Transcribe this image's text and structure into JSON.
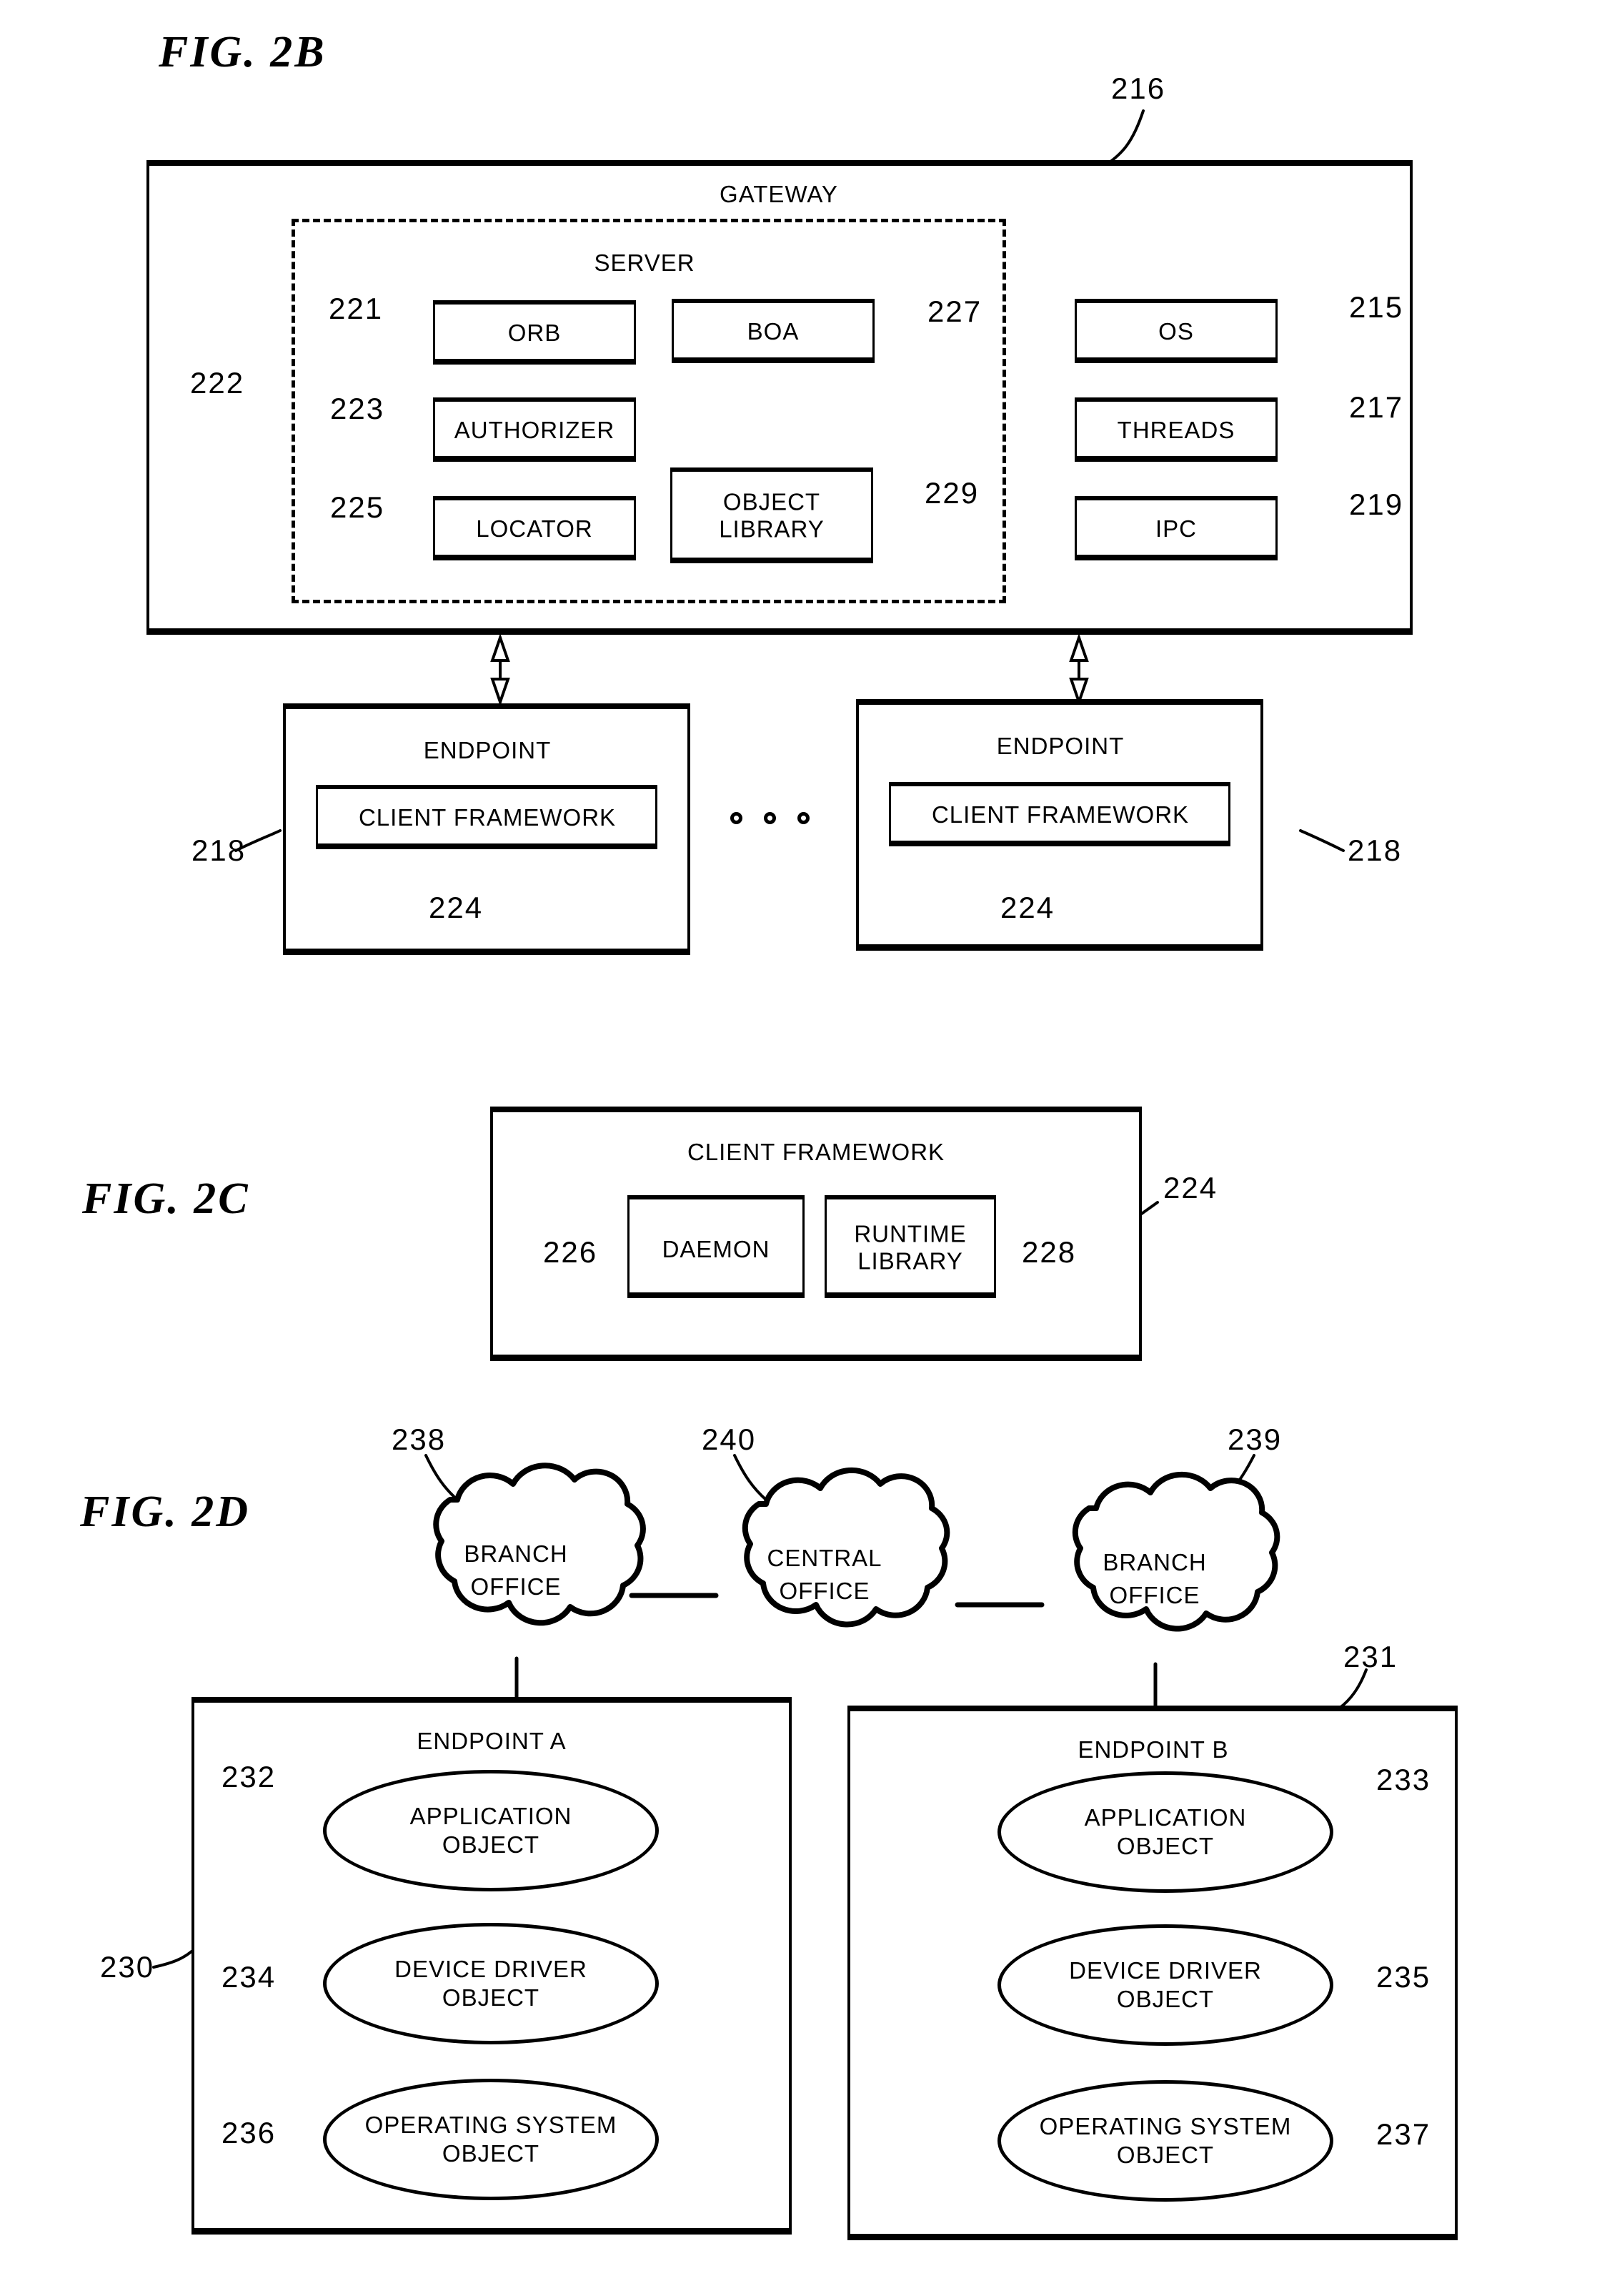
{
  "figures": {
    "fig2b": {
      "title": "FIG.  2B",
      "gateway": {
        "label": "GATEWAY",
        "ref": "216",
        "server": {
          "label": "SERVER",
          "ref": "222",
          "components": [
            {
              "label": "ORB",
              "ref": "221"
            },
            {
              "label": "BOA",
              "ref": "227"
            },
            {
              "label": "AUTHORIZER",
              "ref": "223"
            },
            {
              "label": "LOCATOR",
              "ref": "225"
            },
            {
              "label": "OBJECT LIBRARY",
              "ref": "229"
            }
          ]
        },
        "system_components": [
          {
            "label": "OS",
            "ref": "215"
          },
          {
            "label": "THREADS",
            "ref": "217"
          },
          {
            "label": "IPC",
            "ref": "219"
          }
        ]
      },
      "endpoints": [
        {
          "label": "ENDPOINT",
          "ref": "218",
          "child": {
            "label": "CLIENT FRAMEWORK",
            "ref": "224"
          }
        },
        {
          "label": "ENDPOINT",
          "ref": "218",
          "child": {
            "label": "CLIENT FRAMEWORK",
            "ref": "224"
          }
        }
      ],
      "ellipsis": "o o o"
    },
    "fig2c": {
      "title": "FIG.  2C",
      "frame": {
        "label": "CLIENT FRAMEWORK",
        "ref": "224",
        "components": [
          {
            "label": "DAEMON",
            "ref": "226"
          },
          {
            "label": "RUNTIME LIBRARY",
            "ref": "228"
          }
        ]
      }
    },
    "fig2d": {
      "title": "FIG.  2D",
      "clouds": [
        {
          "line1": "BRANCH",
          "line2": "OFFICE",
          "ref": "238"
        },
        {
          "line1": "CENTRAL",
          "line2": "OFFICE",
          "ref": "240"
        },
        {
          "line1": "BRANCH",
          "line2": "OFFICE",
          "ref": "239"
        }
      ],
      "endpoint_a": {
        "label": "ENDPOINT A",
        "ref": "230",
        "objects": [
          {
            "line1": "APPLICATION",
            "line2": "OBJECT",
            "ref": "232"
          },
          {
            "line1": "DEVICE DRIVER",
            "line2": "OBJECT",
            "ref": "234"
          },
          {
            "line1": "OPERATING SYSTEM",
            "line2": "OBJECT",
            "ref": "236"
          }
        ]
      },
      "endpoint_b": {
        "label": "ENDPOINT B",
        "ref": "231",
        "objects": [
          {
            "line1": "APPLICATION",
            "line2": "OBJECT",
            "ref": "233"
          },
          {
            "line1": "DEVICE DRIVER",
            "line2": "OBJECT",
            "ref": "235"
          },
          {
            "line1": "OPERATING SYSTEM",
            "line2": "OBJECT",
            "ref": "237"
          }
        ]
      }
    }
  },
  "colors": {
    "ink": "#000000",
    "paper": "#ffffff"
  }
}
